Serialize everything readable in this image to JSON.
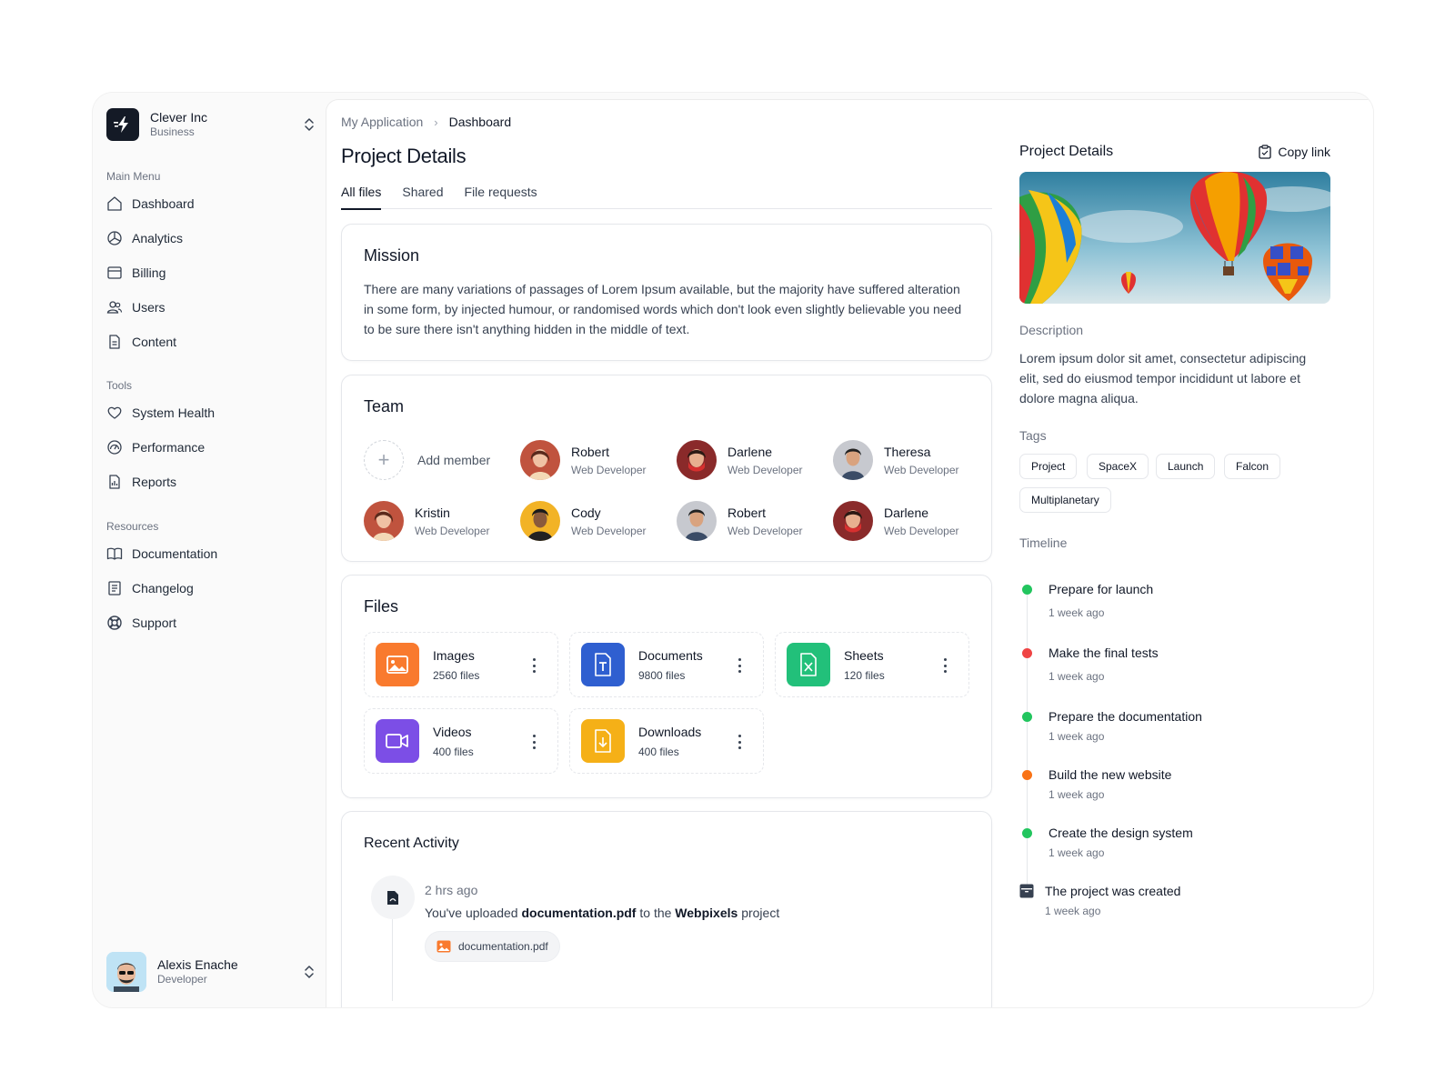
{
  "org": {
    "name": "Clever Inc",
    "plan": "Business"
  },
  "sidebar": {
    "sections": [
      {
        "label": "Main Menu",
        "items": [
          {
            "label": "Dashboard",
            "icon": "home-icon"
          },
          {
            "label": "Analytics",
            "icon": "pie-chart-icon"
          },
          {
            "label": "Billing",
            "icon": "billing-icon"
          },
          {
            "label": "Users",
            "icon": "users-icon"
          },
          {
            "label": "Content",
            "icon": "document-icon"
          }
        ]
      },
      {
        "label": "Tools",
        "items": [
          {
            "label": "System Health",
            "icon": "heart-icon"
          },
          {
            "label": "Performance",
            "icon": "gauge-icon"
          },
          {
            "label": "Reports",
            "icon": "report-icon"
          }
        ]
      },
      {
        "label": "Resources",
        "items": [
          {
            "label": "Documentation",
            "icon": "book-icon"
          },
          {
            "label": "Changelog",
            "icon": "changelog-icon"
          },
          {
            "label": "Support",
            "icon": "lifebuoy-icon"
          }
        ]
      }
    ]
  },
  "user": {
    "name": "Alexis Enache",
    "role": "Developer"
  },
  "breadcrumb": {
    "parent": "My Application",
    "separator": "›",
    "current": "Dashboard"
  },
  "page": {
    "title": "Project Details"
  },
  "tabs": [
    {
      "label": "All files",
      "active": true
    },
    {
      "label": "Shared"
    },
    {
      "label": "File requests"
    }
  ],
  "mission": {
    "title": "Mission",
    "text": "There are many variations of passages of Lorem Ipsum available, but the majority have suffered alteration in some form, by injected humour, or randomised words which don't look even slightly believable you need to be sure there isn't anything hidden in the middle of text."
  },
  "team": {
    "title": "Team",
    "add_label": "Add member",
    "members": [
      {
        "name": "Robert",
        "role": "Web Developer"
      },
      {
        "name": "Darlene",
        "role": "Web Developer"
      },
      {
        "name": "Theresa",
        "role": "Web Developer"
      },
      {
        "name": "Kristin",
        "role": "Web Developer"
      },
      {
        "name": "Cody",
        "role": "Web Developer"
      },
      {
        "name": "Robert",
        "role": "Web Developer"
      },
      {
        "name": "Darlene",
        "role": "Web Developer"
      }
    ]
  },
  "files": {
    "title": "Files",
    "items": [
      {
        "name": "Images",
        "count": "2560 files",
        "color": "#f97a2e",
        "icon": "image-icon"
      },
      {
        "name": "Documents",
        "count": "9800 files",
        "color": "#2f5fd0",
        "icon": "text-document-icon"
      },
      {
        "name": "Sheets",
        "count": "120 files",
        "color": "#22c07a",
        "icon": "spreadsheet-icon"
      },
      {
        "name": "Videos",
        "count": "400 files",
        "color": "#7c4ee6",
        "icon": "video-icon"
      },
      {
        "name": "Downloads",
        "count": "400 files",
        "color": "#f5b017",
        "icon": "download-icon"
      }
    ]
  },
  "activity": {
    "title": "Recent Activity",
    "time": "2 hrs ago",
    "text_before": "You've uploaded",
    "file": "documentation.pdf",
    "text_middle": "to the",
    "project": "Webpixels",
    "text_after": "project",
    "attachment": "documentation.pdf"
  },
  "details": {
    "title": "Project Details",
    "copy_label": "Copy link",
    "description_label": "Description",
    "description": "Lorem ipsum dolor sit amet, consectetur adipiscing elit, sed do eiusmod tempor incididunt ut labore et dolore magna aliqua.",
    "tags_label": "Tags",
    "tags": [
      "Project",
      "SpaceX",
      "Launch",
      "Falcon",
      "Multiplanetary"
    ],
    "timeline_label": "Timeline",
    "timeline": [
      {
        "title": "Prepare for launch",
        "time": "1 week ago",
        "color": "#22c55e"
      },
      {
        "title": "Make the final tests",
        "time": "1 week ago",
        "color": "#ef4444"
      },
      {
        "title": "Prepare the documentation",
        "time": "1 week ago",
        "color": "#22c55e"
      },
      {
        "title": "Build the new website",
        "time": "1 week ago",
        "color": "#f97316"
      },
      {
        "title": "Create the design system",
        "time": "1 week ago",
        "color": "#22c55e"
      },
      {
        "title": "The project was created",
        "time": "1 week ago",
        "color": "#374151"
      }
    ]
  }
}
